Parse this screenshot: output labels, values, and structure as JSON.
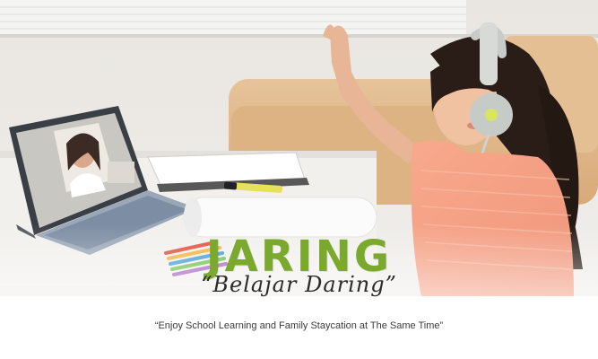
{
  "banner": {
    "title": "JARING",
    "subtitle": "“Belajar Daring”",
    "tagline": "“Enjoy School Learning and Family Staycation at The Same Time”"
  },
  "colors": {
    "brand_green": "#7aa92e",
    "text_dark": "#2b2b2b"
  }
}
